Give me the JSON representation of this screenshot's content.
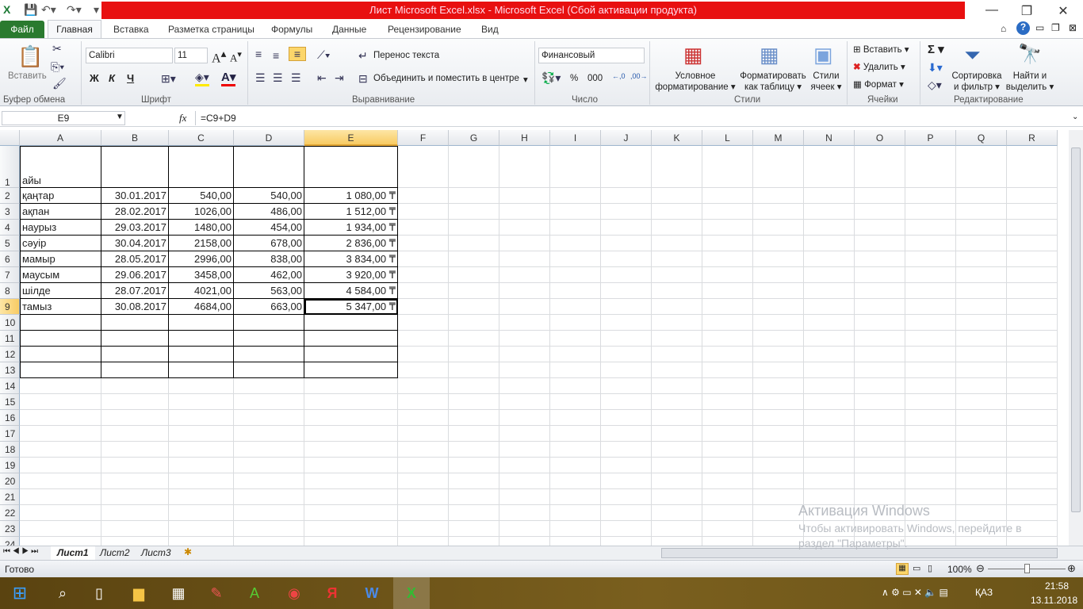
{
  "window": {
    "title": "Лист Microsoft Excel.xlsx  -  Microsoft Excel (Сбой активации продукта)"
  },
  "ribbon_tabs": [
    "Файл",
    "Главная",
    "Вставка",
    "Разметка страницы",
    "Формулы",
    "Данные",
    "Рецензирование",
    "Вид"
  ],
  "ribbon": {
    "paste": "Вставить",
    "clipboard_group": "Буфер обмена",
    "font_name": "Calibri",
    "font_size": "11",
    "bold": "Ж",
    "italic": "К",
    "underline": "Ч",
    "font_group": "Шрифт",
    "wrap_text": "Перенос текста",
    "merge_center": "Объединить и поместить в центре",
    "alignment_group": "Выравнивание",
    "number_format": "Финансовый",
    "percent": "%",
    "thousands": "000",
    "number_group": "Число",
    "conditional_formatting": [
      "Условное",
      "форматирование ▾"
    ],
    "format_as_table": [
      "Форматировать",
      "как таблицу ▾"
    ],
    "cell_styles": [
      "Стили",
      "ячеек ▾"
    ],
    "styles_group": "Стили",
    "insert": "Вставить",
    "delete": "Удалить",
    "format": "Формат",
    "cells_group": "Ячейки",
    "sort_filter": [
      "Сортировка",
      "и фильтр ▾"
    ],
    "find_select": [
      "Найти и",
      "выделить ▾"
    ],
    "editing_group": "Редактирование"
  },
  "formula_bar": {
    "name_box": "E9",
    "fx": "fx",
    "formula": "=C9+D9"
  },
  "columns": [
    "A",
    "B",
    "C",
    "D",
    "E",
    "F",
    "G",
    "H",
    "I",
    "J",
    "K",
    "L",
    "M",
    "N",
    "O",
    "P",
    "Q",
    "R"
  ],
  "selected_cell": "E9",
  "rows": [
    [
      "айы",
      "",
      "",
      "",
      ""
    ],
    [
      "қаңтар",
      "30.01.2017",
      "540,00",
      "540,00",
      "1 080,00 ₸"
    ],
    [
      "ақпан",
      "28.02.2017",
      "1026,00",
      "486,00",
      "1 512,00 ₸"
    ],
    [
      "наурыз",
      "29.03.2017",
      "1480,00",
      "454,00",
      "1 934,00 ₸"
    ],
    [
      "сәуір",
      "30.04.2017",
      "2158,00",
      "678,00",
      "2 836,00 ₸"
    ],
    [
      "мамыр",
      "28.05.2017",
      "2996,00",
      "838,00",
      "3 834,00 ₸"
    ],
    [
      "маусым",
      "29.06.2017",
      "3458,00",
      "462,00",
      "3 920,00 ₸"
    ],
    [
      "шілде",
      "28.07.2017",
      "4021,00",
      "563,00",
      "4 584,00 ₸"
    ],
    [
      "тамыз",
      "30.08.2017",
      "4684,00",
      "663,00",
      "5 347,00 ₸"
    ]
  ],
  "sheets": [
    "Лист1",
    "Лист2",
    "Лист3"
  ],
  "status": {
    "ready": "Готово",
    "zoom": "100%"
  },
  "watermark": {
    "title": "Активация Windows",
    "line1": "Чтобы активировать Windows, перейдите в",
    "line2": "раздел \"Параметры\"."
  },
  "taskbar": {
    "time": "21:58",
    "date": "13.11.2018",
    "lang": "ҚАЗ"
  }
}
